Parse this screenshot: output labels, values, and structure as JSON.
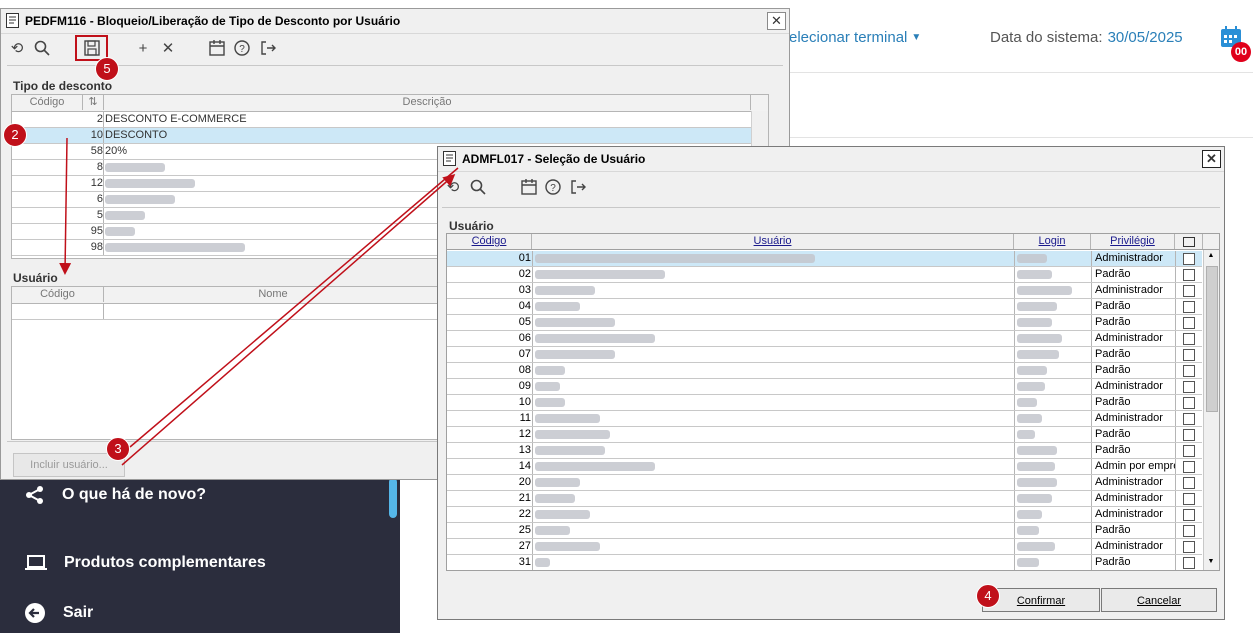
{
  "app": {
    "terminal_label": "elecionar terminal",
    "system_date_label": "Data do sistema:",
    "system_date_value": "30/05/2025",
    "calendar_badge": "00"
  },
  "side_menu": {
    "items": [
      {
        "label": "O que há de novo?",
        "icon": "share-icon"
      },
      {
        "label": "Produtos complementares",
        "icon": "laptop-icon"
      },
      {
        "label": "Sair",
        "icon": "exit-circle-icon"
      }
    ]
  },
  "window_main": {
    "title": "PEDFM116 - Bloqueio/Liberação de Tipo de Desconto por Usuário",
    "toolbar": [
      "undo-icon",
      "search-icon",
      "save-icon",
      "add-icon",
      "delete-icon",
      "calendar-icon",
      "help-icon",
      "exit-icon"
    ],
    "tipo_group_label": "Tipo de desconto",
    "tipo_columns": [
      "Código",
      "Descrição"
    ],
    "tipo_rows": [
      {
        "codigo": "2",
        "descricao": "DESCONTO E-COMMERCE"
      },
      {
        "codigo": "10",
        "descricao": "DESCONTO"
      },
      {
        "codigo": "58",
        "descricao": "20%"
      },
      {
        "codigo": "8",
        "descricao": ""
      },
      {
        "codigo": "12",
        "descricao": ""
      },
      {
        "codigo": "6",
        "descricao": ""
      },
      {
        "codigo": "5",
        "descricao": ""
      },
      {
        "codigo": "95",
        "descricao": ""
      },
      {
        "codigo": "98",
        "descricao": ""
      }
    ],
    "usuario_group_label": "Usuário",
    "usuario_columns": [
      "Código",
      "Nome"
    ],
    "incluir_button": "Incluir usuário..."
  },
  "window_select": {
    "title": "ADMFL017 - Seleção de Usuário",
    "toolbar": [
      "undo-icon",
      "search-icon",
      "calendar-icon",
      "help-icon",
      "exit-icon"
    ],
    "group_label": "Usuário",
    "columns": [
      "Código",
      "Usuário",
      "Login",
      "Privilégio"
    ],
    "rows": [
      {
        "codigo": "01",
        "privilegio": "Administrador"
      },
      {
        "codigo": "02",
        "privilegio": "Padrão"
      },
      {
        "codigo": "03",
        "privilegio": "Administrador"
      },
      {
        "codigo": "04",
        "privilegio": "Padrão"
      },
      {
        "codigo": "05",
        "privilegio": "Padrão"
      },
      {
        "codigo": "06",
        "privilegio": "Administrador"
      },
      {
        "codigo": "07",
        "privilegio": "Padrão"
      },
      {
        "codigo": "08",
        "privilegio": "Padrão"
      },
      {
        "codigo": "09",
        "privilegio": "Administrador"
      },
      {
        "codigo": "10",
        "privilegio": "Padrão"
      },
      {
        "codigo": "11",
        "privilegio": "Administrador"
      },
      {
        "codigo": "12",
        "privilegio": "Padrão"
      },
      {
        "codigo": "13",
        "privilegio": "Padrão"
      },
      {
        "codigo": "14",
        "privilegio": "Admin por empre"
      },
      {
        "codigo": "20",
        "privilegio": "Administrador"
      },
      {
        "codigo": "21",
        "privilegio": "Administrador"
      },
      {
        "codigo": "22",
        "privilegio": "Administrador"
      },
      {
        "codigo": "25",
        "privilegio": "Padrão"
      },
      {
        "codigo": "27",
        "privilegio": "Administrador"
      },
      {
        "codigo": "31",
        "privilegio": "Padrão"
      }
    ],
    "confirm_button": "Confirmar",
    "cancel_button": "Cancelar"
  },
  "annotations": {
    "step_2": "2",
    "step_3": "3",
    "step_4": "4",
    "step_5": "5",
    "color": "#c0101a"
  }
}
